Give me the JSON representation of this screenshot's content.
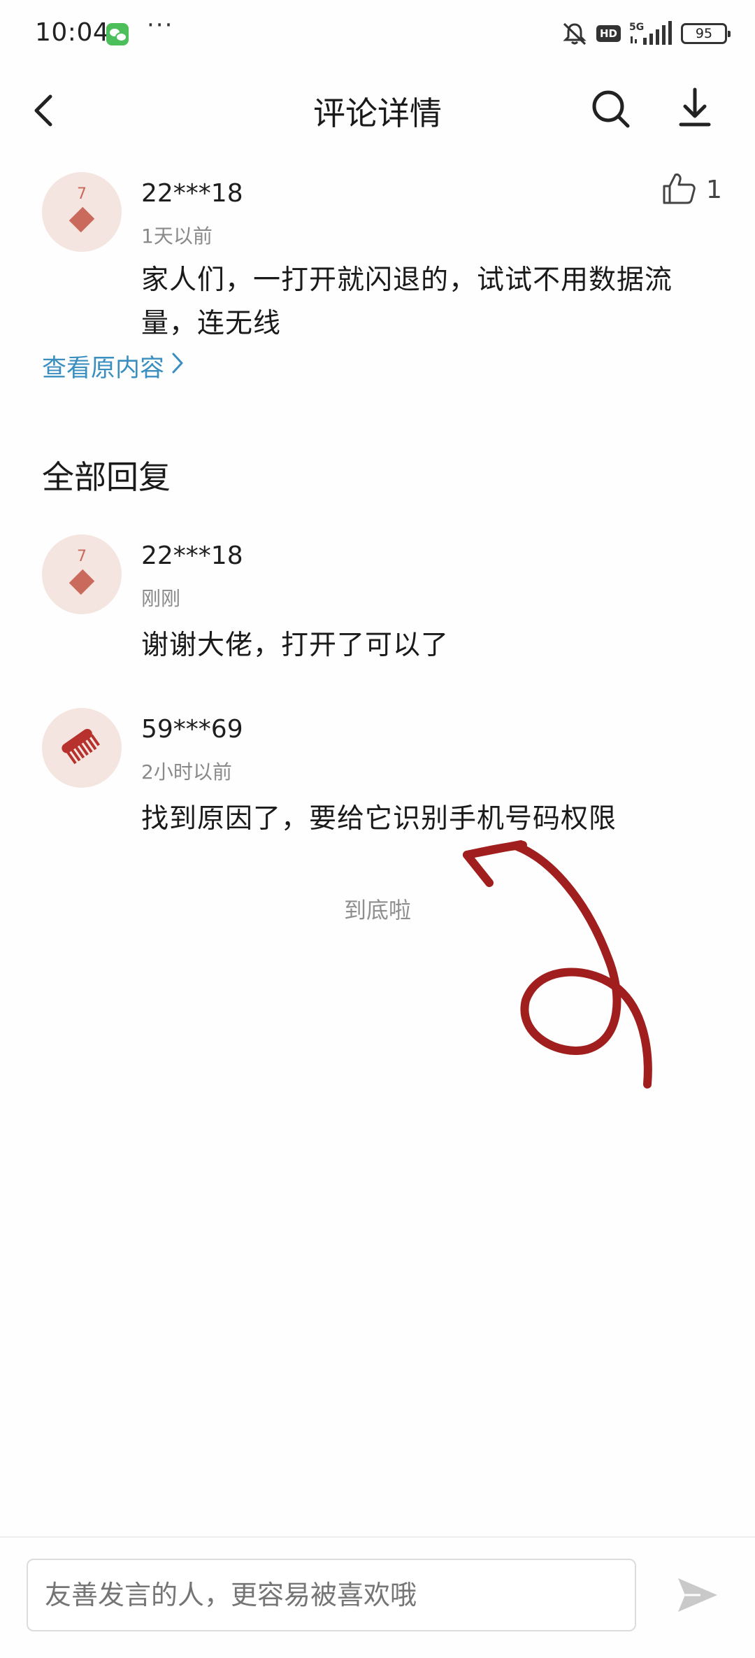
{
  "status_bar": {
    "time": "10:04",
    "more": "···",
    "network": "5G",
    "hd_label": "HD",
    "battery": "95"
  },
  "header": {
    "title": "评论详情"
  },
  "main_comment": {
    "username": "22***18",
    "avatar_digit": "7",
    "time_ago": "1天以前",
    "text": "家人们，一打开就闪退的，试试不用数据流量，连无线",
    "like_count": "1",
    "view_original": "查看原内容"
  },
  "replies_section": {
    "title": "全部回复",
    "replies": [
      {
        "username": "22***18",
        "avatar_digit": "7",
        "time_ago": "刚刚",
        "text": "谢谢大佬，打开了可以了"
      },
      {
        "username": "59***69",
        "time_ago": "2小时以前",
        "text": "找到原因了，要给它识别手机号码权限"
      }
    ],
    "end_text": "到底啦"
  },
  "input_bar": {
    "placeholder": "友善发言的人，更容易被喜欢哦"
  },
  "colors": {
    "link": "#3a8fc0",
    "annotation": "#a01e1e",
    "avatar_bg": "#f4e5e0",
    "avatar_mark": "#c96a5c"
  }
}
